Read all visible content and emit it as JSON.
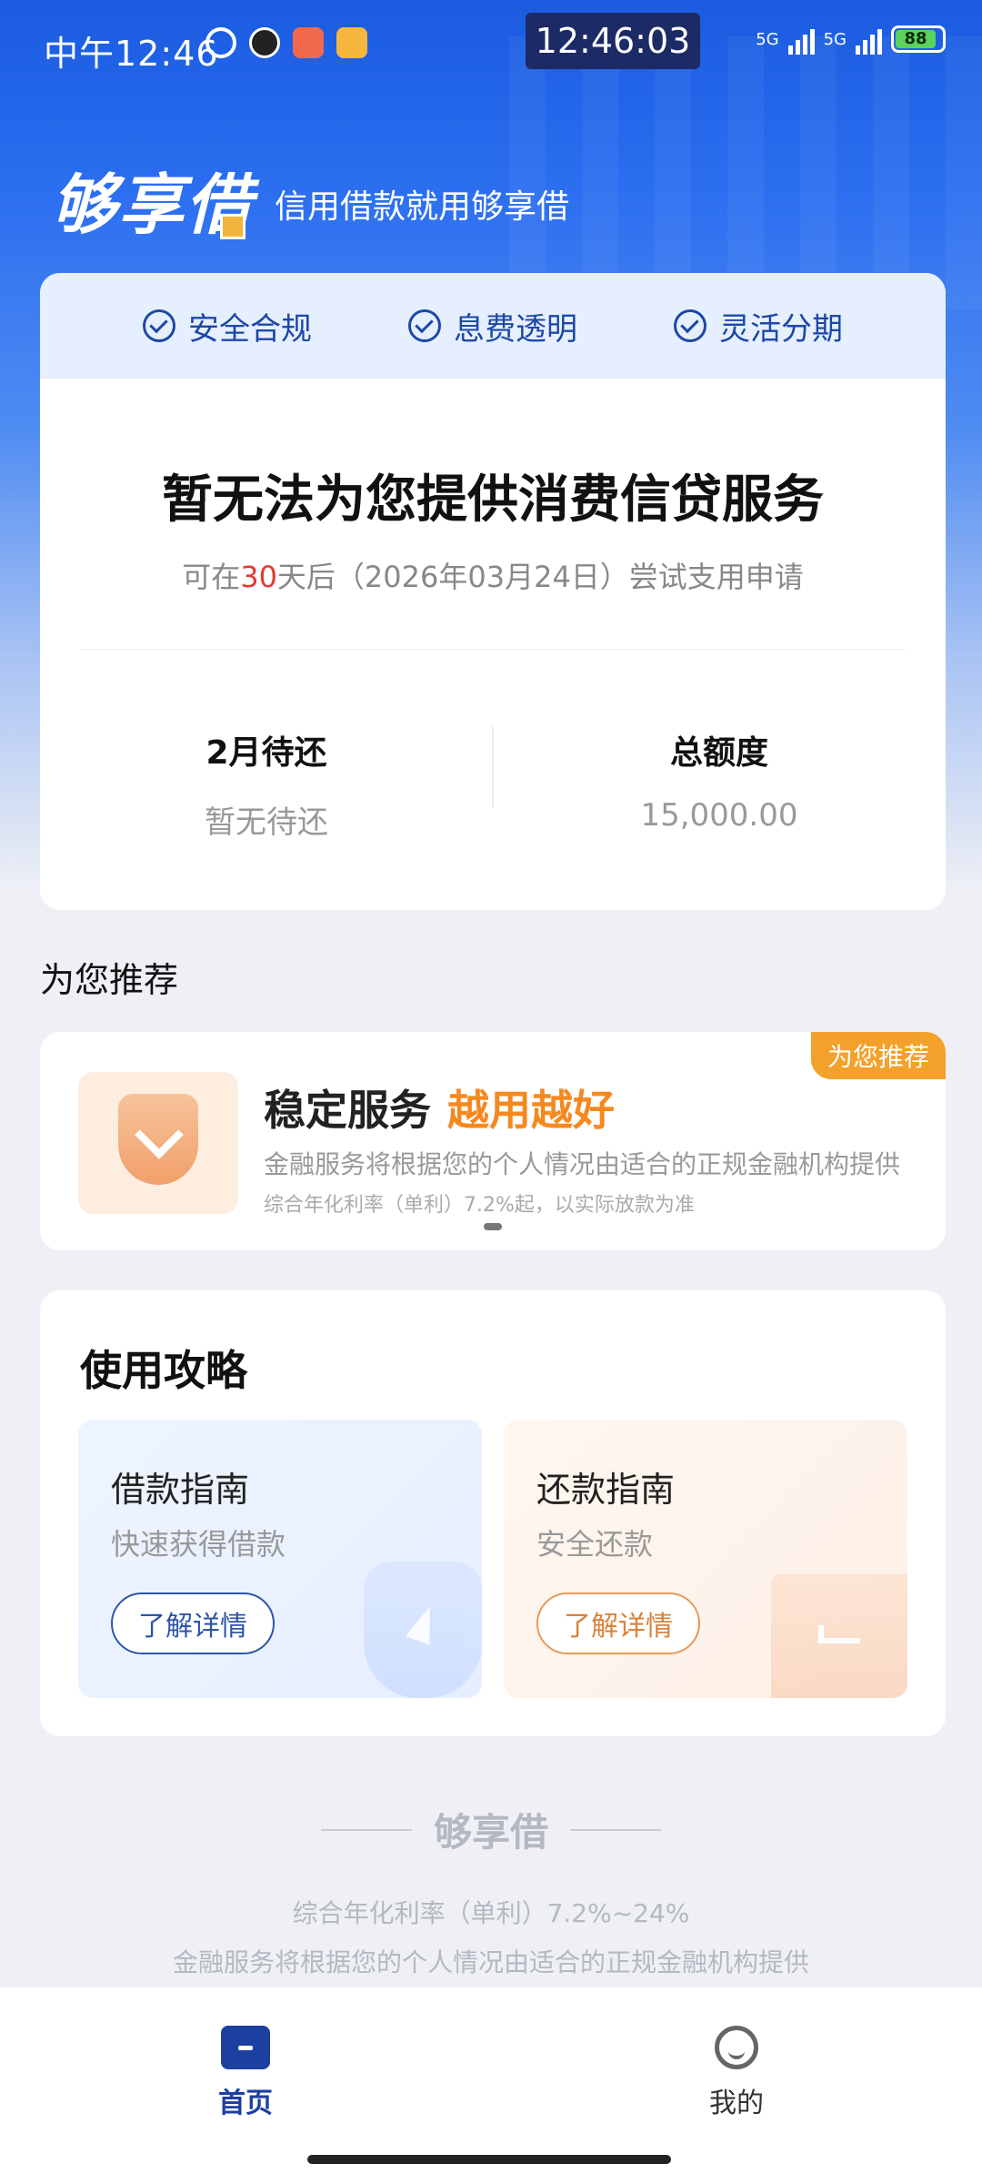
{
  "status_bar": {
    "time_left": "中午12:46",
    "time_center": "12:46:03",
    "network1": "5G",
    "network2": "5G",
    "battery": "88"
  },
  "header": {
    "logo": "够享借",
    "slogan": "信用借款就用够享借"
  },
  "features": [
    {
      "label": "安全合规"
    },
    {
      "label": "息费透明"
    },
    {
      "label": "灵活分期"
    }
  ],
  "main": {
    "title": "暂无法为您提供消费信贷服务",
    "sub_prefix": "可在",
    "sub_days": "30",
    "sub_suffix": "天后（2026年03月24日）尝试支用申请",
    "stats": [
      {
        "label": "2月待还",
        "value": "暂无待还"
      },
      {
        "label": "总额度",
        "value": "15,000.00"
      }
    ]
  },
  "recommend": {
    "section_title": "为您推荐",
    "badge": "为您推荐",
    "heading": "稳定服务",
    "heading_accent": "越用越好",
    "desc": "金融服务将根据您的个人情况由适合的正规金融机构提供",
    "note": "综合年化利率（单利）7.2%起，以实际放款为准"
  },
  "guide": {
    "title": "使用攻略",
    "items": [
      {
        "title": "借款指南",
        "sub": "快速获得借款",
        "button": "了解详情"
      },
      {
        "title": "还款指南",
        "sub": "安全还款",
        "button": "了解详情"
      }
    ]
  },
  "footer": {
    "brand": "够享借",
    "line1": "综合年化利率（单利）7.2%~24%",
    "line2": "金融服务将根据您的个人情况由适合的正规金融机构提供"
  },
  "bottom_nav": [
    {
      "label": "首页",
      "icon": "home-icon",
      "active": true
    },
    {
      "label": "我的",
      "icon": "profile-icon",
      "active": false
    }
  ],
  "colors": {
    "brand_blue": "#1a5be0",
    "accent_orange": "#f5891f",
    "highlight_red": "#e53935"
  }
}
